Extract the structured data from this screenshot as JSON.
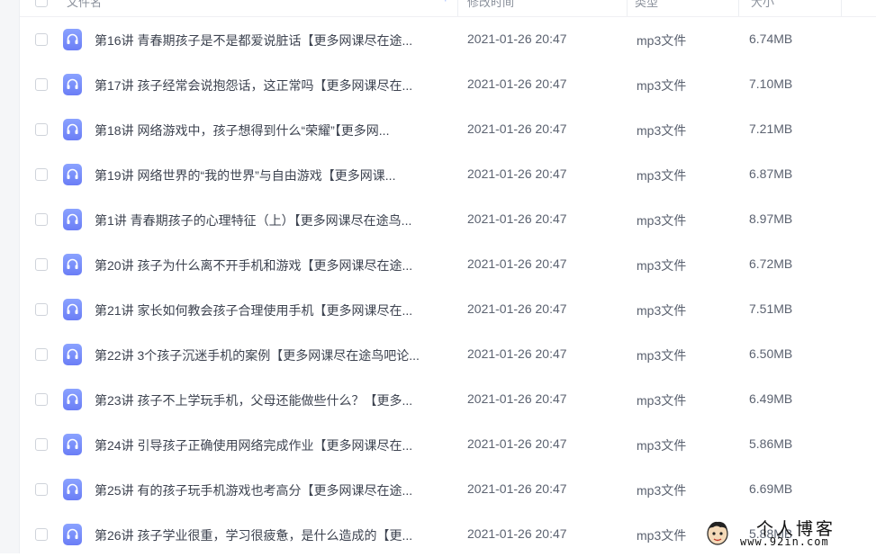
{
  "header": {
    "name_label": "文件名",
    "time_label": "修改时间",
    "type_label": "类型",
    "size_label": "大小",
    "sort_indicator": "↑"
  },
  "files": [
    {
      "name": "第16讲 青春期孩子是不是都爱说脏话【更多网课尽在途...",
      "time": "2021-01-26 20:47",
      "type": "mp3文件",
      "size": "6.74MB",
      "icon": "audio-file-icon"
    },
    {
      "name": "第17讲 孩子经常会说抱怨话，这正常吗【更多网课尽在...",
      "time": "2021-01-26 20:47",
      "type": "mp3文件",
      "size": "7.10MB",
      "icon": "audio-file-icon"
    },
    {
      "name": "第18讲 网络游戏中，孩子想得到什么“荣耀”【更多网...",
      "time": "2021-01-26 20:47",
      "type": "mp3文件",
      "size": "7.21MB",
      "icon": "audio-file-icon"
    },
    {
      "name": "第19讲 网络世界的“我的世界”与自由游戏【更多网课...",
      "time": "2021-01-26 20:47",
      "type": "mp3文件",
      "size": "6.87MB",
      "icon": "audio-file-icon"
    },
    {
      "name": "第1讲 青春期孩子的心理特征（上）【更多网课尽在途鸟...",
      "time": "2021-01-26 20:47",
      "type": "mp3文件",
      "size": "8.97MB",
      "icon": "audio-file-icon"
    },
    {
      "name": "第20讲 孩子为什么离不开手机和游戏【更多网课尽在途...",
      "time": "2021-01-26 20:47",
      "type": "mp3文件",
      "size": "6.72MB",
      "icon": "audio-file-icon"
    },
    {
      "name": "第21讲 家长如何教会孩子合理使用手机【更多网课尽在...",
      "time": "2021-01-26 20:47",
      "type": "mp3文件",
      "size": "7.51MB",
      "icon": "audio-file-icon"
    },
    {
      "name": "第22讲 3个孩子沉迷手机的案例【更多网课尽在途鸟吧论...",
      "time": "2021-01-26 20:47",
      "type": "mp3文件",
      "size": "6.50MB",
      "icon": "audio-file-icon"
    },
    {
      "name": "第23讲 孩子不上学玩手机，父母还能做些什么？【更多...",
      "time": "2021-01-26 20:47",
      "type": "mp3文件",
      "size": "6.49MB",
      "icon": "audio-file-icon"
    },
    {
      "name": "第24讲 引导孩子正确使用网络完成作业【更多网课尽在...",
      "time": "2021-01-26 20:47",
      "type": "mp3文件",
      "size": "5.86MB",
      "icon": "audio-file-icon"
    },
    {
      "name": "第25讲 有的孩子玩手机游戏也考高分【更多网课尽在途...",
      "time": "2021-01-26 20:47",
      "type": "mp3文件",
      "size": "6.69MB",
      "icon": "audio-file-icon"
    },
    {
      "name": "第26讲 孩子学业很重，学习很疲惫，是什么造成的【更...",
      "time": "2021-01-26 20:47",
      "type": "mp3文件",
      "size": "5.88MB",
      "icon": "audio-file-icon"
    }
  ],
  "watermark": {
    "title": "个人博客",
    "url": "www.92in.com"
  },
  "colors": {
    "icon_accent": "#6b7ef6",
    "sort_accent": "#4f7cff"
  }
}
